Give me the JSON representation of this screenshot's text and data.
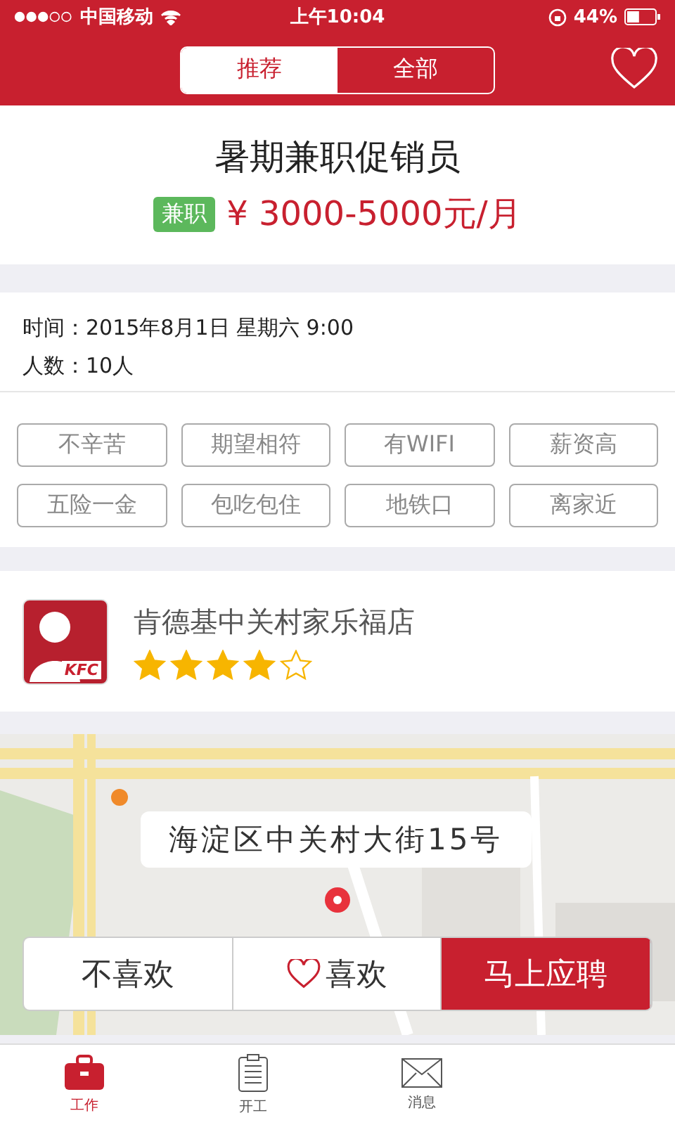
{
  "status_bar": {
    "carrier": "中国移动",
    "time": "上午10:04",
    "battery": "44%"
  },
  "header": {
    "tabs": [
      {
        "label": "推荐",
        "selected": true
      },
      {
        "label": "全部",
        "selected": false
      }
    ]
  },
  "job": {
    "title": "暑期兼职促销员",
    "type_badge": "兼职",
    "salary": "¥ 3000-5000元/月"
  },
  "details": [
    "时间：2015年8月1日 星期六 9:00",
    "人数：10人"
  ],
  "tags": [
    "不辛苦",
    "期望相符",
    "有WIFI",
    "薪资高",
    "五险一金",
    "包吃包住",
    "地铁口",
    "离家近"
  ],
  "store": {
    "name": "肯德基中关村家乐福店",
    "logo_text": "KFC",
    "stars": 4
  },
  "map": {
    "kind": "picture",
    "address": "海淀区中关村大街15号"
  },
  "actions": [
    {
      "label": "不喜欢",
      "kind": "plain"
    },
    {
      "label": "喜欢",
      "kind": "heart"
    },
    {
      "label": "马上应聘",
      "kind": "primary"
    }
  ],
  "tab_bar": [
    {
      "label": "工作",
      "selected": true
    },
    {
      "label": "开工",
      "selected": false
    },
    {
      "label": "消息",
      "selected": false
    }
  ]
}
